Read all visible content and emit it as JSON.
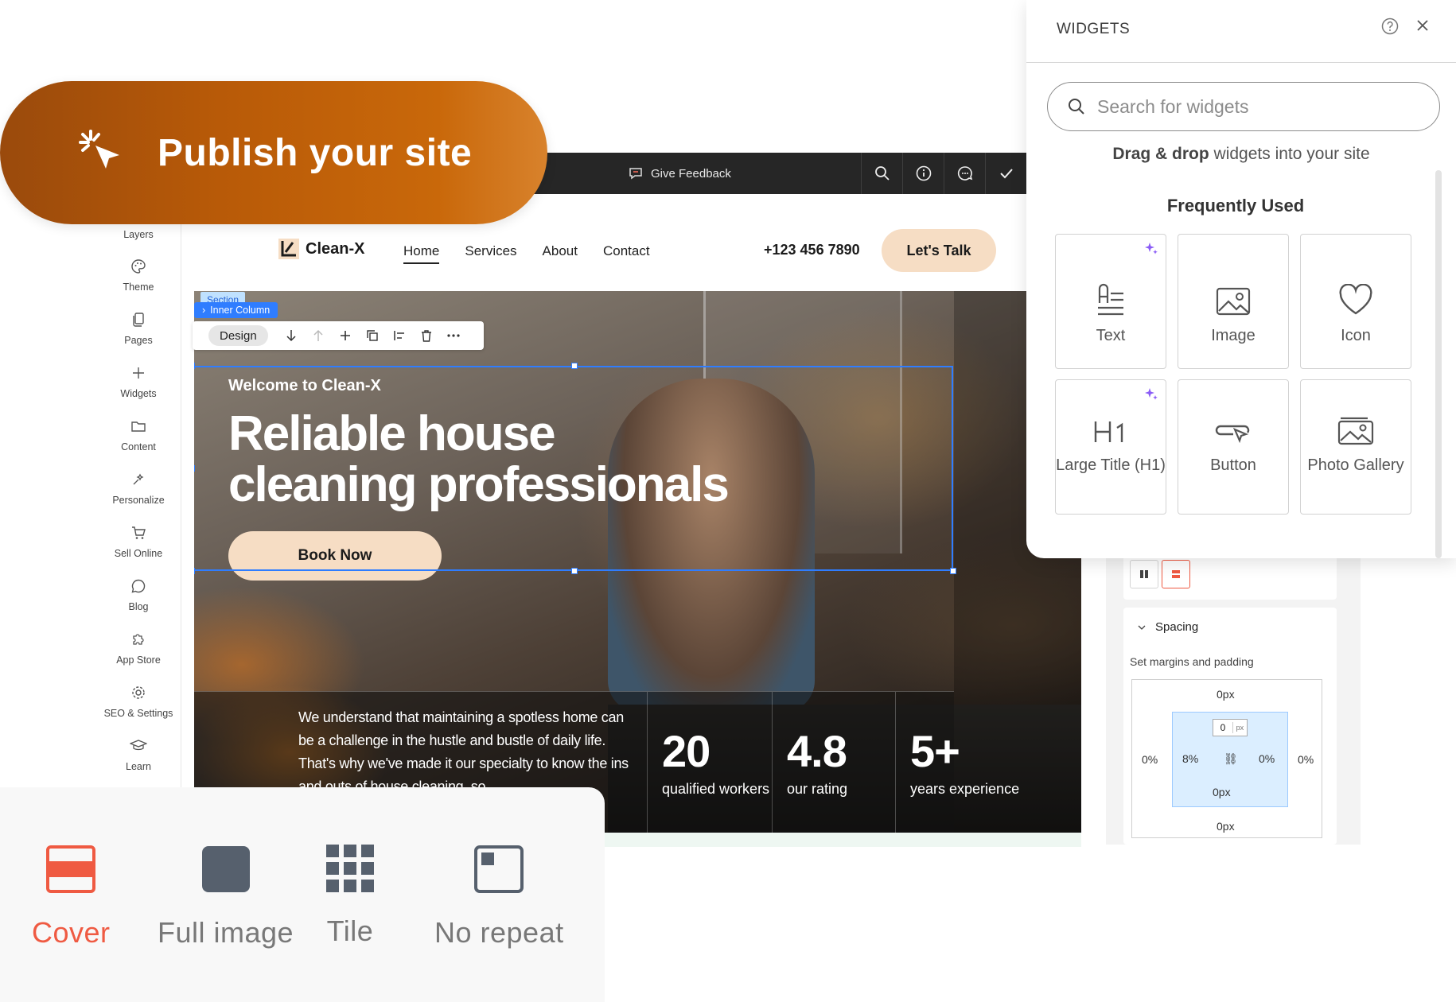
{
  "promo": {
    "title": "Publish your site"
  },
  "topbar": {
    "feedback": "Give Feedback"
  },
  "sidebar": {
    "items": [
      {
        "label": "Layers",
        "icon": "layers-icon"
      },
      {
        "label": "Theme",
        "icon": "palette-icon"
      },
      {
        "label": "Pages",
        "icon": "pages-icon"
      },
      {
        "label": "Widgets",
        "icon": "plus-icon"
      },
      {
        "label": "Content",
        "icon": "folder-icon"
      },
      {
        "label": "Personalize",
        "icon": "personalize-icon"
      },
      {
        "label": "Sell Online",
        "icon": "cart-icon"
      },
      {
        "label": "Blog",
        "icon": "chat-icon"
      },
      {
        "label": "App Store",
        "icon": "puzzle-icon"
      },
      {
        "label": "SEO & Settings",
        "icon": "gear-icon"
      },
      {
        "label": "Learn",
        "icon": "graduation-cap-icon"
      }
    ]
  },
  "site": {
    "brand": "Clean-X",
    "nav": [
      "Home",
      "Services",
      "About",
      "Contact"
    ],
    "phone": "+123 456 7890",
    "cta": "Let's Talk",
    "section_chip": "Section",
    "inner_column_chip": "Inner Column",
    "design_label": "Design",
    "welcome": "Welcome to Clean-X",
    "hero_title": "Reliable house cleaning professionals",
    "book_now": "Book Now",
    "paragraph": "We understand that maintaining a spotless home can be a challenge in the hustle and bustle of daily life. That's why we've made it our specialty to know the ins and outs of house cleaning, so",
    "stats": [
      {
        "number": "20",
        "label": "qualified workers"
      },
      {
        "number": "4.8",
        "label": "our rating"
      },
      {
        "number": "5+",
        "label": "years experience"
      }
    ]
  },
  "inspector": {
    "spacing_title": "Spacing",
    "spacing_sub": "Set margins and padding",
    "margin_top": "0px",
    "margin_bottom": "0px",
    "margin_left": "0%",
    "margin_right": "0%",
    "padding_top_value": "0",
    "padding_top_unit": "px",
    "padding_left": "8%",
    "padding_right": "0%",
    "padding_bottom": "0px"
  },
  "widgets": {
    "title": "WIDGETS",
    "search_placeholder": "Search for widgets",
    "drag_bold": "Drag & drop",
    "drag_rest": " widgets into your site",
    "section_title": "Frequently Used",
    "items": [
      {
        "label": "Text",
        "icon": "text-icon",
        "ai": true
      },
      {
        "label": "Image",
        "icon": "image-icon",
        "ai": false
      },
      {
        "label": "Icon",
        "icon": "heart-icon",
        "ai": false
      },
      {
        "label": "Large Title (H1)",
        "icon": "h1-icon",
        "ai": true
      },
      {
        "label": "Button",
        "icon": "button-icon",
        "ai": false
      },
      {
        "label": "Photo Gallery",
        "icon": "gallery-icon",
        "ai": false
      }
    ]
  },
  "background_options": {
    "selected": "Cover",
    "items": [
      "Cover",
      "Full image",
      "Tile",
      "No repeat"
    ]
  },
  "colors": {
    "accent": "#ef5a42",
    "selection": "#2f7dff",
    "promo": "#c9680a",
    "cta": "#f6ddc4"
  }
}
